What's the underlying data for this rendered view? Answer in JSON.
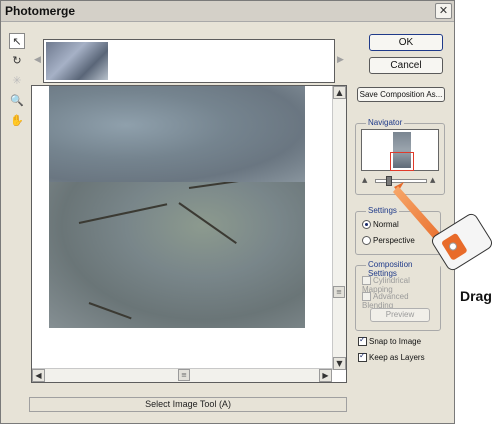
{
  "window": {
    "title": "Photomerge",
    "close_glyph": "✕"
  },
  "toolbar": {
    "tools": [
      {
        "name": "select-image-tool",
        "glyph": "↖",
        "active": true,
        "disabled": false
      },
      {
        "name": "rotate-image-tool",
        "glyph": "↻",
        "active": false,
        "disabled": false
      },
      {
        "name": "set-vanishing-point-tool",
        "glyph": "✳",
        "active": false,
        "disabled": true
      },
      {
        "name": "zoom-tool",
        "glyph": "🔍",
        "active": false,
        "disabled": false
      },
      {
        "name": "hand-tool",
        "glyph": "✋",
        "active": false,
        "disabled": false
      }
    ]
  },
  "filmstrip": {
    "left_arrow": "◀",
    "right_arrow": "▶"
  },
  "scrollbars": {
    "up": "▲",
    "down": "▼",
    "left": "◀",
    "right": "▶",
    "thumb": "≡"
  },
  "status_text": "Select Image Tool (A)",
  "buttons": {
    "ok": "OK",
    "cancel": "Cancel",
    "save_composition": "Save Composition As..."
  },
  "navigator": {
    "label": "Navigator",
    "zoom_out_icon": "zoom-out-icon",
    "zoom_in_icon": "zoom-in-icon",
    "zoom_out_glyph": "▲",
    "zoom_in_glyph": "▲"
  },
  "settings": {
    "label": "Settings",
    "options": [
      {
        "label": "Normal",
        "selected": true
      },
      {
        "label": "Perspective",
        "selected": false
      }
    ]
  },
  "composition_settings": {
    "label": "Composition Settings",
    "cylindrical_mapping": {
      "label": "Cylindrical Mapping",
      "checked": false,
      "enabled": false
    },
    "advanced_blending": {
      "label": "Advanced Blending",
      "checked": false,
      "enabled": false
    },
    "preview_label": "Preview"
  },
  "snap_to_image": {
    "label": "Snap to Image",
    "checked": true
  },
  "keep_as_layers": {
    "label": "Keep as Layers",
    "checked": true
  },
  "callout": {
    "label": "Drag",
    "accent": "#e86b2a"
  },
  "colors": {
    "accent_blue": "#1f3a8a",
    "navigator_box": "#e03a2a"
  }
}
